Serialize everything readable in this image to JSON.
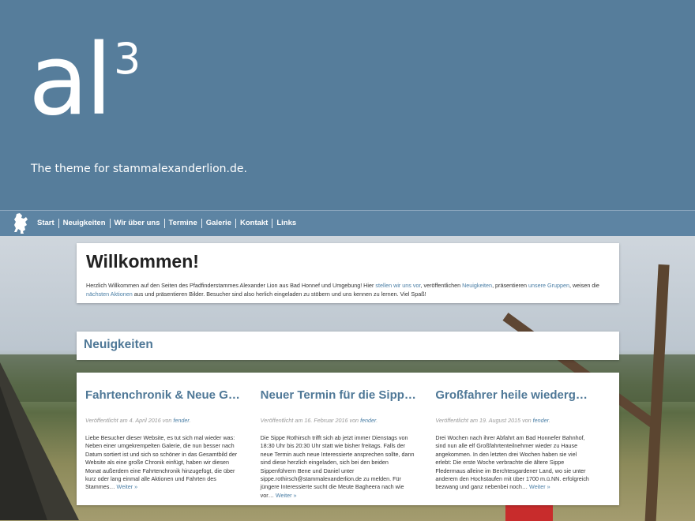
{
  "header": {
    "logo_main": "al",
    "logo_sup": "3",
    "tagline": "The theme for stammalexanderlion.de."
  },
  "nav": {
    "items": [
      "Start",
      "Neuigkeiten",
      "Wir über uns",
      "Termine",
      "Galerie",
      "Kontakt",
      "Links"
    ]
  },
  "welcome": {
    "title": "Willkommen!",
    "text_1": "Herzlich Willkommen auf den Seiten des Pfadfinderstammes Alexander Lion aus Bad Honnef und Umgebung! Hier ",
    "link_1": "stellen wir uns vor",
    "text_2": ", veröffentlichen ",
    "link_2": "Neuigkeiten",
    "text_3": ", präsentieren ",
    "link_3": "unsere Gruppen",
    "text_4": ", weisen die ",
    "link_4": "nächsten Aktionen",
    "text_5": " aus und präsentieren Bilder. Besucher sind also herlich eingeladen zu stöbern und uns kennen zu lernen. Viel Spaß!"
  },
  "news": {
    "heading": "Neuigkeiten",
    "posts": [
      {
        "title": "Fahrtenchronik & Neue Galerie",
        "meta_prefix": "Veröffentlicht am 4. April 2016 von ",
        "author": "fender",
        "meta_suffix": ".",
        "excerpt": "Liebe Besucher dieser Website, es tut sich mal wieder was: Neben einer umgekrempelten Galerie, die nun besser nach Datum sortiert ist und sich so schöner in das Gesamtbild der Website als eine große Chronik einfügt, haben wir diesen Monat außerdem eine Fahrtenchronik hinzugefügt, die über kurz oder lang einmal alle Aktionen und Fahrten des Stammes…",
        "more": "Weiter »"
      },
      {
        "title": "Neuer Termin für die Sippe Rothirsch",
        "meta_prefix": "Veröffentlicht am 16. Februar 2016 von ",
        "author": "fender",
        "meta_suffix": ".",
        "excerpt": "Die Sippe Rothirsch trifft sich ab jetzt immer Dienstags von 18:30 Uhr bis 20:30 Uhr statt wie bisher freitags. Falls der neue Termin auch neue Interessierte ansprechen sollte, dann sind diese herzlich eingeladen, sich bei den beiden Sippenführern Bene und Daniel unter sippe.rothirsch@stammalexanderlion.de zu melden. Für jüngere Interessierte sucht die Meute Bagheera nach wie vor…",
        "more": "Weiter »"
      },
      {
        "title": "Großfahrer heile wiedergekehrt",
        "meta_prefix": "Veröffentlicht am 19. August 2015 von ",
        "author": "fender",
        "meta_suffix": ".",
        "excerpt": "Drei Wochen nach ihrer Abfahrt am Bad Honnefer Bahnhof, sind nun alle elf Großfahrtenteilnehmer wieder zu Hause angekommen. In den letzten drei Wochen haben sie viel erlebt: Die erste Woche verbrachte die ältere Sippe Fledermaus alleine im Berchtesgardener Land, wo sie unter anderem den Hochstaufen mit über 1700 m.ü.NN. erfolgreich bezwang und ganz nebenbei noch…",
        "more": "Weiter »"
      }
    ]
  }
}
